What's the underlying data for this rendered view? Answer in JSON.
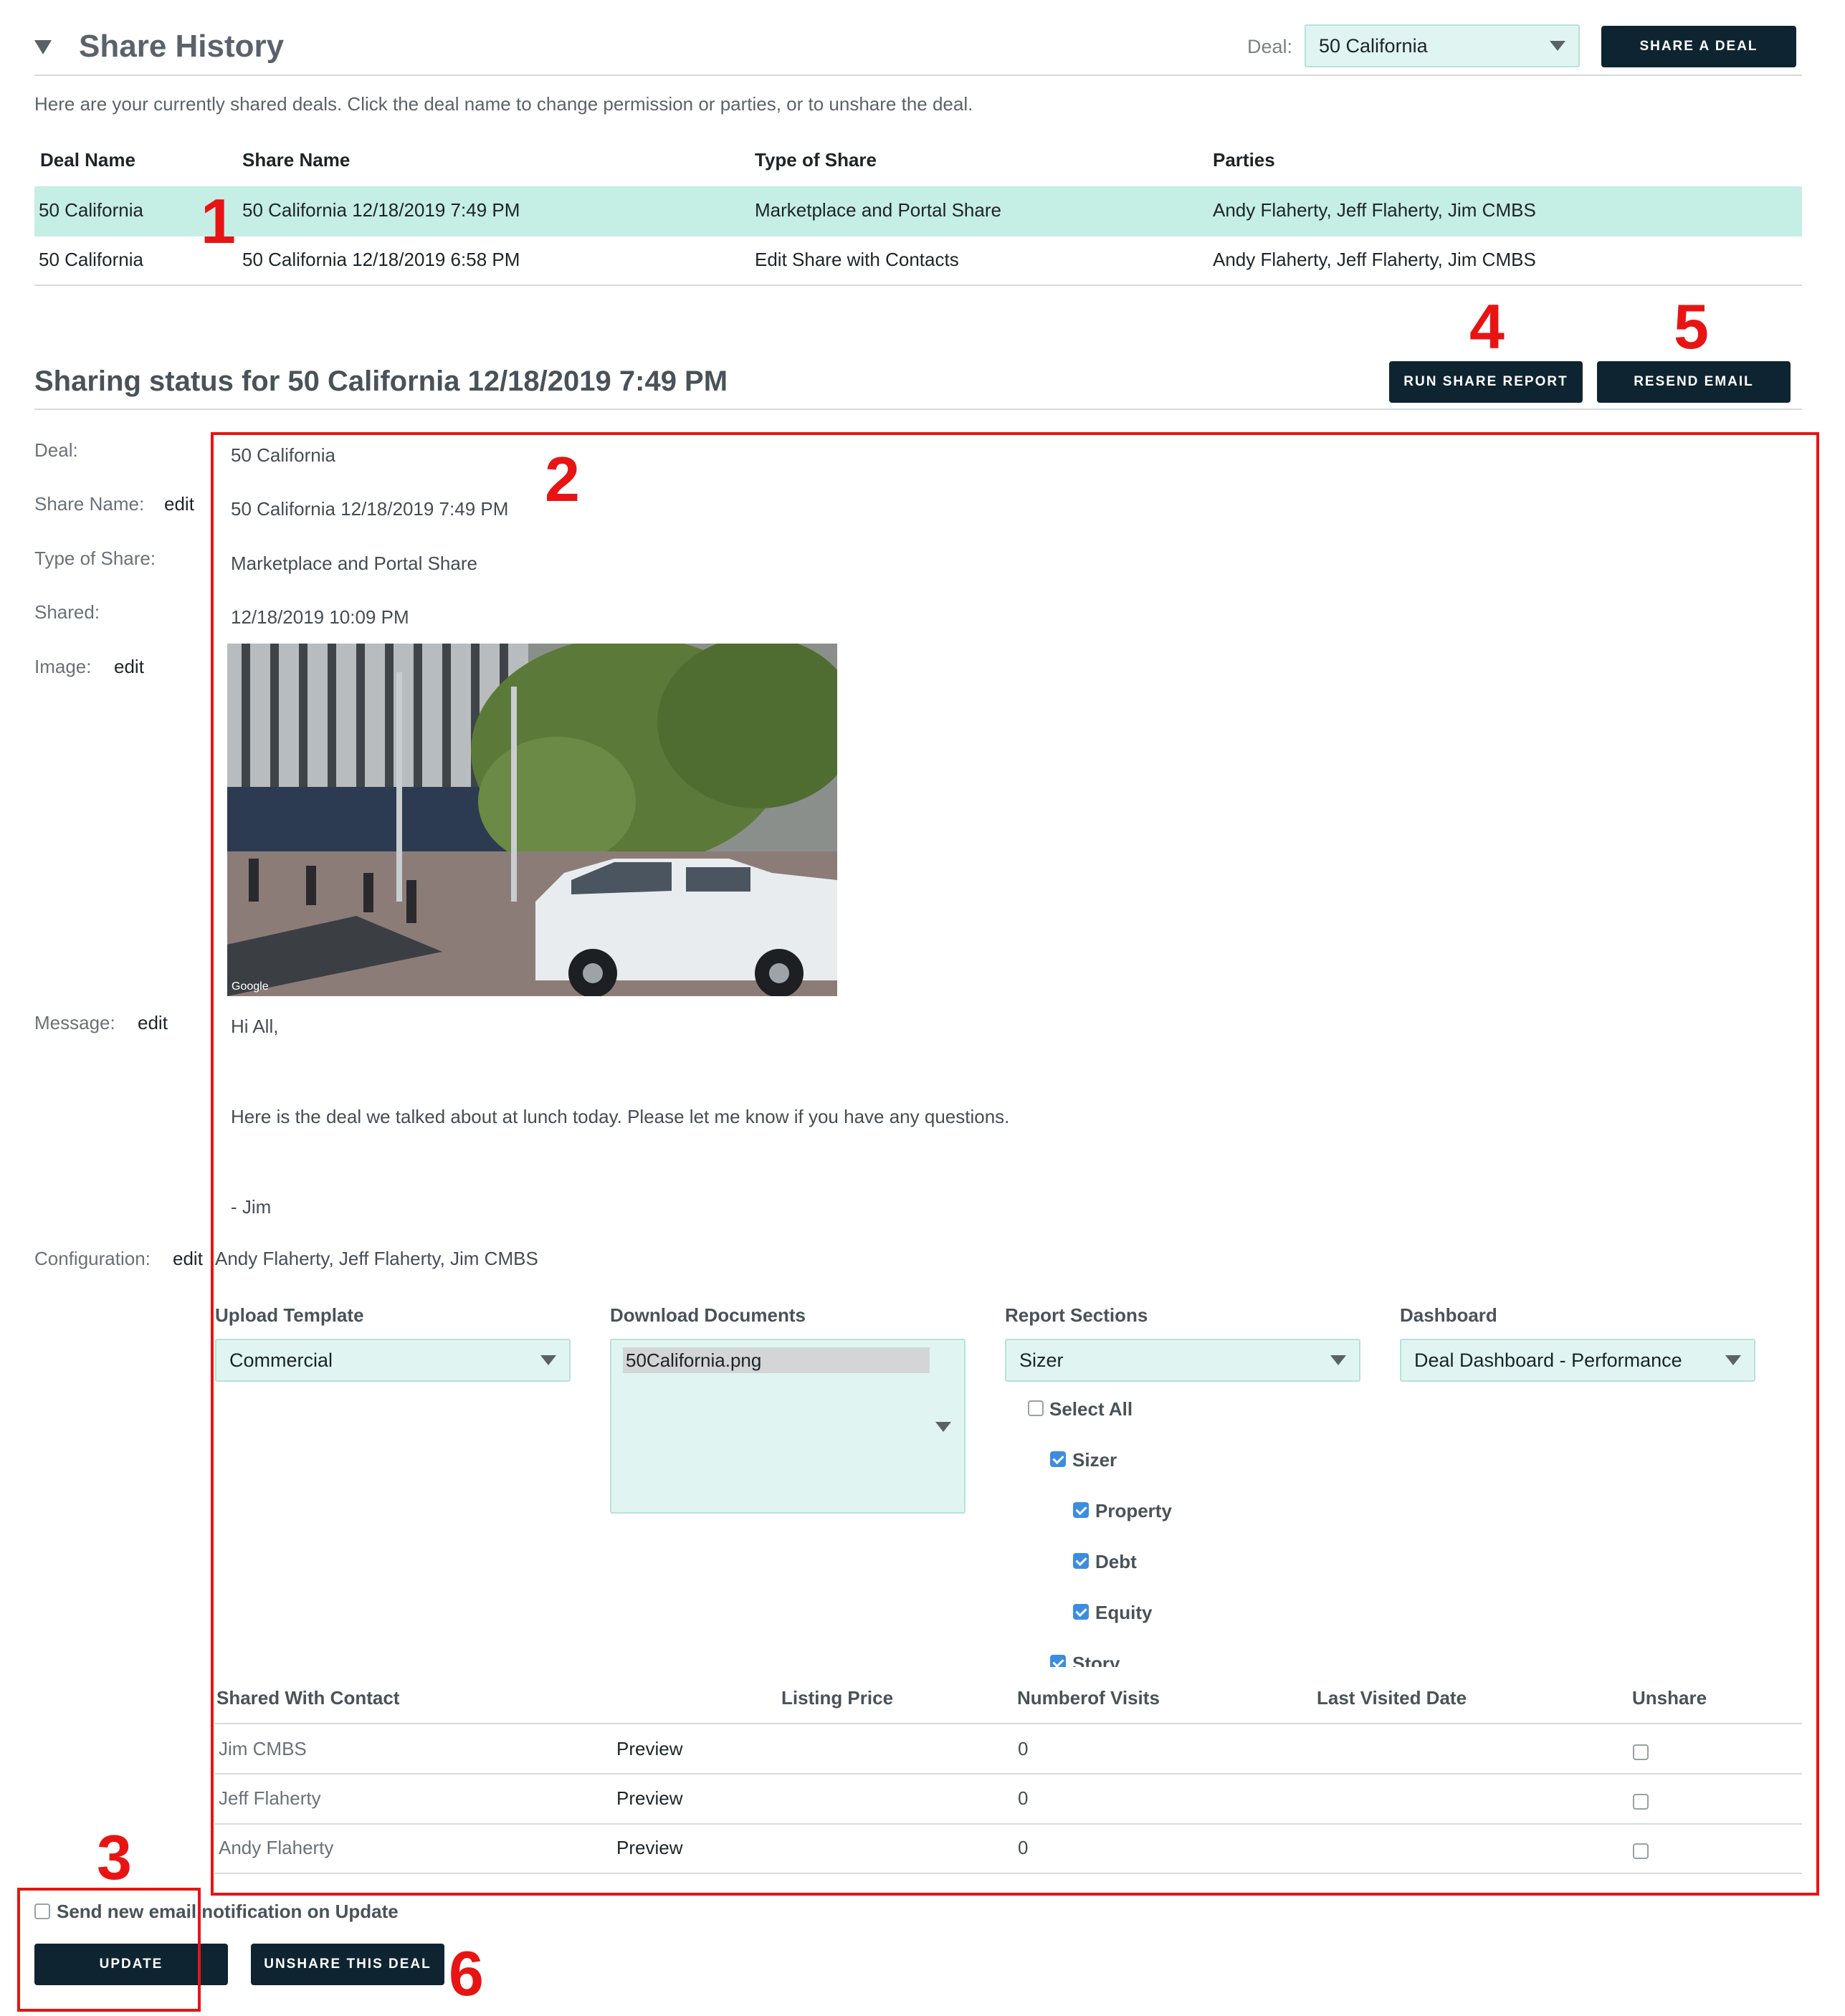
{
  "header": {
    "title": "Share History",
    "deal_label": "Deal:",
    "deal_value": "50 California",
    "share_button": "SHARE A DEAL",
    "intro": "Here are your currently shared deals. Click the deal name to change permission or parties, or to unshare the deal."
  },
  "history_table": {
    "columns": [
      "Deal Name",
      "Share Name",
      "Type of Share",
      "Parties"
    ],
    "rows": [
      [
        "50 California",
        "50 California 12/18/2019 7:49 PM",
        "Marketplace and Portal Share",
        "Andy Flaherty, Jeff Flaherty, Jim CMBS"
      ],
      [
        "50 California",
        "50 California 12/18/2019 6:58 PM",
        "Edit Share with Contacts",
        "Andy Flaherty, Jeff Flaherty, Jim CMBS"
      ]
    ]
  },
  "status": {
    "title": "Sharing status for 50 California 12/18/2019 7:49 PM",
    "run_report_button": "RUN SHARE REPORT",
    "resend_button": "RESEND EMAIL",
    "labels": {
      "deal": "Deal:",
      "share_name": "Share Name:",
      "type": "Type of Share:",
      "shared": "Shared:",
      "image": "Image:",
      "message": "Message:",
      "configuration": "Configuration:",
      "edit": "edit"
    },
    "values": {
      "deal": "50 California",
      "share_name": "50 California 12/18/2019 7:49 PM",
      "type": "Marketplace and Portal Share",
      "shared": "12/18/2019 10:09 PM",
      "image_watermark": "Google",
      "message_greeting": "Hi All,",
      "message_body": "Here is the deal we talked about at lunch today. Please let me know if you have any questions.",
      "message_sign": "- Jim",
      "configuration_parties": "Andy Flaherty, Jeff Flaherty, Jim CMBS"
    }
  },
  "config": {
    "upload_template_label": "Upload Template",
    "upload_template_value": "Commercial",
    "download_docs_label": "Download Documents",
    "download_docs_value": "50California.png",
    "report_sections_label": "Report Sections",
    "report_sections_value": "Sizer",
    "dashboard_label": "Dashboard",
    "dashboard_value": "Deal Dashboard - Performance",
    "sections": [
      {
        "label": "Select All",
        "checked": false
      },
      {
        "label": "Sizer",
        "checked": true
      },
      {
        "label": "Property",
        "checked": true
      },
      {
        "label": "Debt",
        "checked": true
      },
      {
        "label": "Equity",
        "checked": true
      },
      {
        "label": "Story",
        "checked": true
      }
    ]
  },
  "contacts_table": {
    "columns": [
      "Shared With Contact",
      "Listing Price",
      "Numberof Visits",
      "Last Visited Date",
      "Unshare"
    ],
    "preview_label": "Preview",
    "rows": [
      {
        "name": "Jim CMBS",
        "visits": "0"
      },
      {
        "name": "Jeff Flaherty",
        "visits": "0"
      },
      {
        "name": "Andy Flaherty",
        "visits": "0"
      }
    ]
  },
  "footer": {
    "notify_label": "Send new email notification on Update",
    "update_button": "UPDATE",
    "unshare_button": "UNSHARE THIS DEAL"
  },
  "annotations": [
    "1",
    "2",
    "3",
    "4",
    "5",
    "6"
  ],
  "colors": {
    "accent_teal": "#c5eee5",
    "button_navy": "#0f2431",
    "annotation_red": "#e81414",
    "checkbox_blue": "#3b8de0"
  }
}
